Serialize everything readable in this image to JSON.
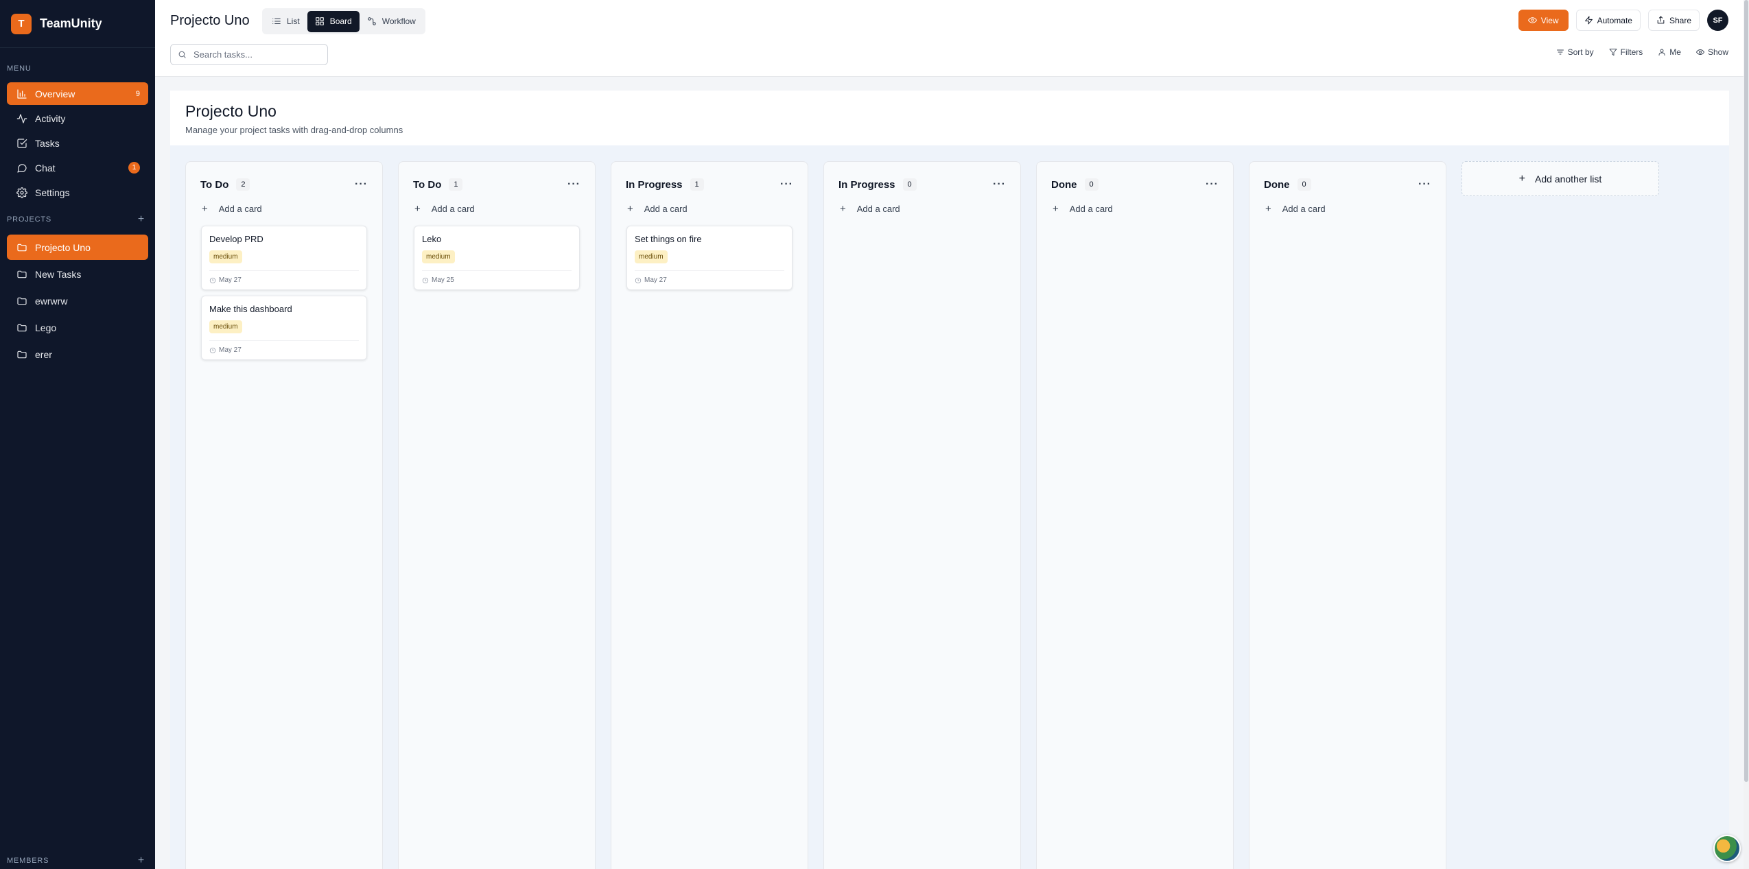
{
  "app": {
    "logo_letter": "T",
    "name": "TeamUnity"
  },
  "sidebar": {
    "menu_label": "MENU",
    "menu": [
      {
        "label": "Overview",
        "icon": "bar-chart-icon",
        "count": "9",
        "active": true
      },
      {
        "label": "Activity",
        "icon": "activity-icon"
      },
      {
        "label": "Tasks",
        "icon": "check-square-icon"
      },
      {
        "label": "Chat",
        "icon": "chat-icon",
        "badge": "1"
      },
      {
        "label": "Settings",
        "icon": "gear-icon"
      }
    ],
    "projects_label": "PROJECTS",
    "projects": [
      {
        "label": "Projecto Uno",
        "active": true
      },
      {
        "label": "New Tasks"
      },
      {
        "label": "ewrwrw"
      },
      {
        "label": "Lego"
      },
      {
        "label": "erer"
      }
    ],
    "members_label": "MEMBERS"
  },
  "topbar": {
    "title": "Projecto Uno",
    "views": {
      "list": "List",
      "board": "Board",
      "workflow": "Workflow"
    },
    "actions": {
      "view": "View",
      "automate": "Automate",
      "share": "Share"
    },
    "avatar": "SF",
    "search_placeholder": "Search tasks...",
    "filters": {
      "sort": "Sort by",
      "filters": "Filters",
      "me": "Me",
      "show": "Show"
    }
  },
  "main": {
    "title": "Projecto Uno",
    "subtitle": "Manage your project tasks with drag-and-drop columns"
  },
  "board": {
    "add_card": "Add a card",
    "add_list": "Add another list",
    "columns": [
      {
        "title": "To Do",
        "count": "2",
        "cards": [
          {
            "title": "Develop PRD",
            "priority": "medium",
            "date": "May 27"
          },
          {
            "title": "Make this dashboard",
            "priority": "medium",
            "date": "May 27"
          }
        ]
      },
      {
        "title": "To Do",
        "count": "1",
        "cards": [
          {
            "title": "Leko",
            "priority": "medium",
            "date": "May 25"
          }
        ]
      },
      {
        "title": "In Progress",
        "count": "1",
        "cards": [
          {
            "title": "Set things on fire",
            "priority": "medium",
            "date": "May 27"
          }
        ]
      },
      {
        "title": "In Progress",
        "count": "0",
        "cards": []
      },
      {
        "title": "Done",
        "count": "0",
        "cards": []
      },
      {
        "title": "Done",
        "count": "0",
        "cards": []
      }
    ]
  },
  "colors": {
    "accent": "#ea6a1c",
    "sidebar_bg": "#0f172a",
    "priority_bg": "#fdf0c4"
  }
}
